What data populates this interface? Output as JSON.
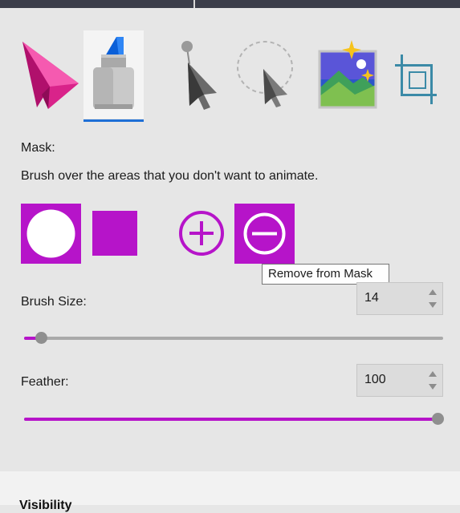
{
  "tools": [
    {
      "name": "Selection",
      "icon": "paper-plane-icon",
      "selected": false
    },
    {
      "name": "Mask",
      "icon": "brush-marker-icon",
      "selected": true
    },
    {
      "name": "Anchor Point",
      "icon": "anchor-pointer-icon",
      "selected": false
    },
    {
      "name": "Motion Path",
      "icon": "motion-path-icon",
      "selected": false
    },
    {
      "name": "Image Adjust",
      "icon": "image-sparkle-icon",
      "selected": false
    },
    {
      "name": "Crop",
      "icon": "crop-icon",
      "selected": false
    }
  ],
  "mask": {
    "label": "Mask:",
    "description": "Brush over the areas that you don't want to animate.",
    "brush_shapes": [
      {
        "name": "circle-brush",
        "selected": true
      },
      {
        "name": "square-brush",
        "selected": false
      }
    ],
    "modes": [
      {
        "name": "add-to-mask",
        "selected": false
      },
      {
        "name": "remove-from-mask",
        "selected": true
      }
    ],
    "tooltip": "Remove from Mask"
  },
  "brush_size": {
    "label": "Brush Size:",
    "value": "14",
    "fraction": 0.035
  },
  "feather": {
    "label": "Feather:",
    "value": "100",
    "fraction": 1.0
  },
  "next_section_title": "Visibility",
  "colors": {
    "accent": "#b614c9",
    "selected_underline": "#1e6fd6"
  }
}
